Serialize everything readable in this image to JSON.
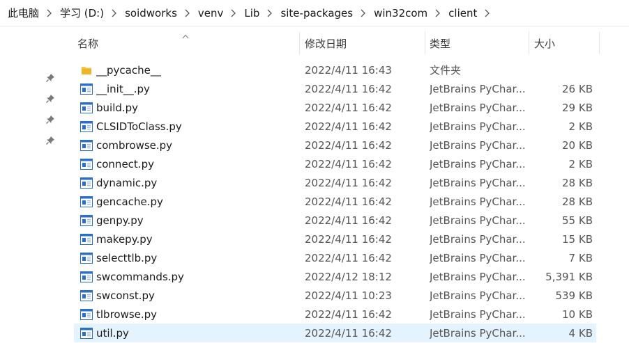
{
  "breadcrumb": [
    {
      "label": "此电脑"
    },
    {
      "label": "学习 (D:)"
    },
    {
      "label": "soidworks"
    },
    {
      "label": "venv"
    },
    {
      "label": "Lib"
    },
    {
      "label": "site-packages"
    },
    {
      "label": "win32com"
    },
    {
      "label": "client"
    }
  ],
  "columns": {
    "name": "名称",
    "date": "修改日期",
    "type": "类型",
    "size": "大小"
  },
  "files": [
    {
      "name": "__pycache__",
      "date": "2022/4/11 16:43",
      "type": "文件夹",
      "size": "",
      "icon": "folder-icon"
    },
    {
      "name": "__init__.py",
      "date": "2022/4/11 16:42",
      "type": "JetBrains PyChar...",
      "size": "26 KB",
      "icon": "python-file-icon"
    },
    {
      "name": "build.py",
      "date": "2022/4/11 16:42",
      "type": "JetBrains PyChar...",
      "size": "29 KB",
      "icon": "python-file-icon"
    },
    {
      "name": "CLSIDToClass.py",
      "date": "2022/4/11 16:42",
      "type": "JetBrains PyChar...",
      "size": "2 KB",
      "icon": "python-file-icon"
    },
    {
      "name": "combrowse.py",
      "date": "2022/4/11 16:42",
      "type": "JetBrains PyChar...",
      "size": "20 KB",
      "icon": "python-file-icon"
    },
    {
      "name": "connect.py",
      "date": "2022/4/11 16:42",
      "type": "JetBrains PyChar...",
      "size": "2 KB",
      "icon": "python-file-icon"
    },
    {
      "name": "dynamic.py",
      "date": "2022/4/11 16:42",
      "type": "JetBrains PyChar...",
      "size": "28 KB",
      "icon": "python-file-icon"
    },
    {
      "name": "gencache.py",
      "date": "2022/4/11 16:42",
      "type": "JetBrains PyChar...",
      "size": "28 KB",
      "icon": "python-file-icon"
    },
    {
      "name": "genpy.py",
      "date": "2022/4/11 16:42",
      "type": "JetBrains PyChar...",
      "size": "55 KB",
      "icon": "python-file-icon"
    },
    {
      "name": "makepy.py",
      "date": "2022/4/11 16:42",
      "type": "JetBrains PyChar...",
      "size": "15 KB",
      "icon": "python-file-icon"
    },
    {
      "name": "selecttlb.py",
      "date": "2022/4/11 16:42",
      "type": "JetBrains PyChar...",
      "size": "7 KB",
      "icon": "python-file-icon"
    },
    {
      "name": "swcommands.py",
      "date": "2022/4/12 18:12",
      "type": "JetBrains PyChar...",
      "size": "5,391 KB",
      "icon": "python-file-icon"
    },
    {
      "name": "swconst.py",
      "date": "2022/4/11 10:23",
      "type": "JetBrains PyChar...",
      "size": "539 KB",
      "icon": "python-file-icon"
    },
    {
      "name": "tlbrowse.py",
      "date": "2022/4/11 16:42",
      "type": "JetBrains PyChar...",
      "size": "10 KB",
      "icon": "python-file-icon"
    },
    {
      "name": "util.py",
      "date": "2022/4/11 16:42",
      "type": "JetBrains PyChar...",
      "size": "4 KB",
      "icon": "python-file-icon",
      "selected": true
    }
  ],
  "pins": [
    "pin-icon",
    "pin-icon",
    "pin-icon",
    "pin-icon"
  ],
  "colors": {
    "selected_row": "#e5f3ff",
    "folder": "#f0c14b",
    "file_icon_blue": "#2a6fc9"
  }
}
